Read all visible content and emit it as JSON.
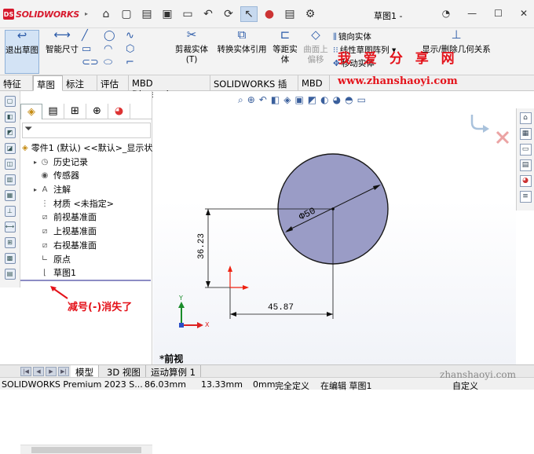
{
  "app": {
    "logo_text": "SOLIDWORKS",
    "doc_title": "草图1 -",
    "title_caret": "▸"
  },
  "qat": {
    "icons": [
      "home-icon",
      "new-icon",
      "open-icon",
      "save-icon",
      "print-icon",
      "undo-icon",
      "rebuild-icon",
      "select-icon",
      "traffic-light-icon",
      "file-props-icon",
      "options-icon"
    ]
  },
  "ribbon": {
    "exit_sketch": "退出草图",
    "smart_dim": "智能尺寸",
    "trim": "剪裁实体(T)",
    "convert": "转换实体引用",
    "offset": "等距实体",
    "surface_offset": "曲面上偏移",
    "mirror": "镜向实体",
    "linear_pattern": "线性草图阵列",
    "move": "移动实体",
    "relations": "显示/删除几何关系"
  },
  "watermark": {
    "title": "我 爱 分 享 网",
    "url": "www.zhanshaoyi.com",
    "bottom": "zhanshaoyi.com"
  },
  "tabs": [
    "特征",
    "草图",
    "标注",
    "评估",
    "MBD Dimensions",
    "SOLIDWORKS 插件",
    "MBD"
  ],
  "tree": {
    "root": "零件1 (默认) <<默认>_显示状",
    "items": [
      {
        "label": "历史记录",
        "toggle": "▸",
        "icon": "history"
      },
      {
        "label": "传感器",
        "toggle": "",
        "icon": "sensor"
      },
      {
        "label": "注解",
        "toggle": "▸",
        "icon": "annotation"
      },
      {
        "label": "材质 <未指定>",
        "toggle": "",
        "icon": "material"
      },
      {
        "label": "前视基准面",
        "toggle": "",
        "icon": "plane"
      },
      {
        "label": "上视基准面",
        "toggle": "",
        "icon": "plane"
      },
      {
        "label": "右视基准面",
        "toggle": "",
        "icon": "plane"
      },
      {
        "label": "原点",
        "toggle": "",
        "icon": "origin"
      },
      {
        "label": "草图1",
        "toggle": "",
        "icon": "sketch"
      }
    ]
  },
  "annotation": "减号(-)消失了",
  "graphics": {
    "diameter_dim": "Φ50",
    "vertical_dim": "36.23",
    "horizontal_dim": "45.87",
    "view_name": "*前视",
    "axis_x": "X",
    "axis_y": "Y"
  },
  "bottom_tabs": [
    "模型",
    "3D 视图",
    "运动算例 1"
  ],
  "status": {
    "product": "SOLIDWORKS Premium 2023 S...",
    "x": "86.03mm",
    "y": "13.33mm",
    "z": "0mm",
    "state": "完全定义",
    "editing": "在编辑 草图1",
    "custom": "自定义"
  }
}
